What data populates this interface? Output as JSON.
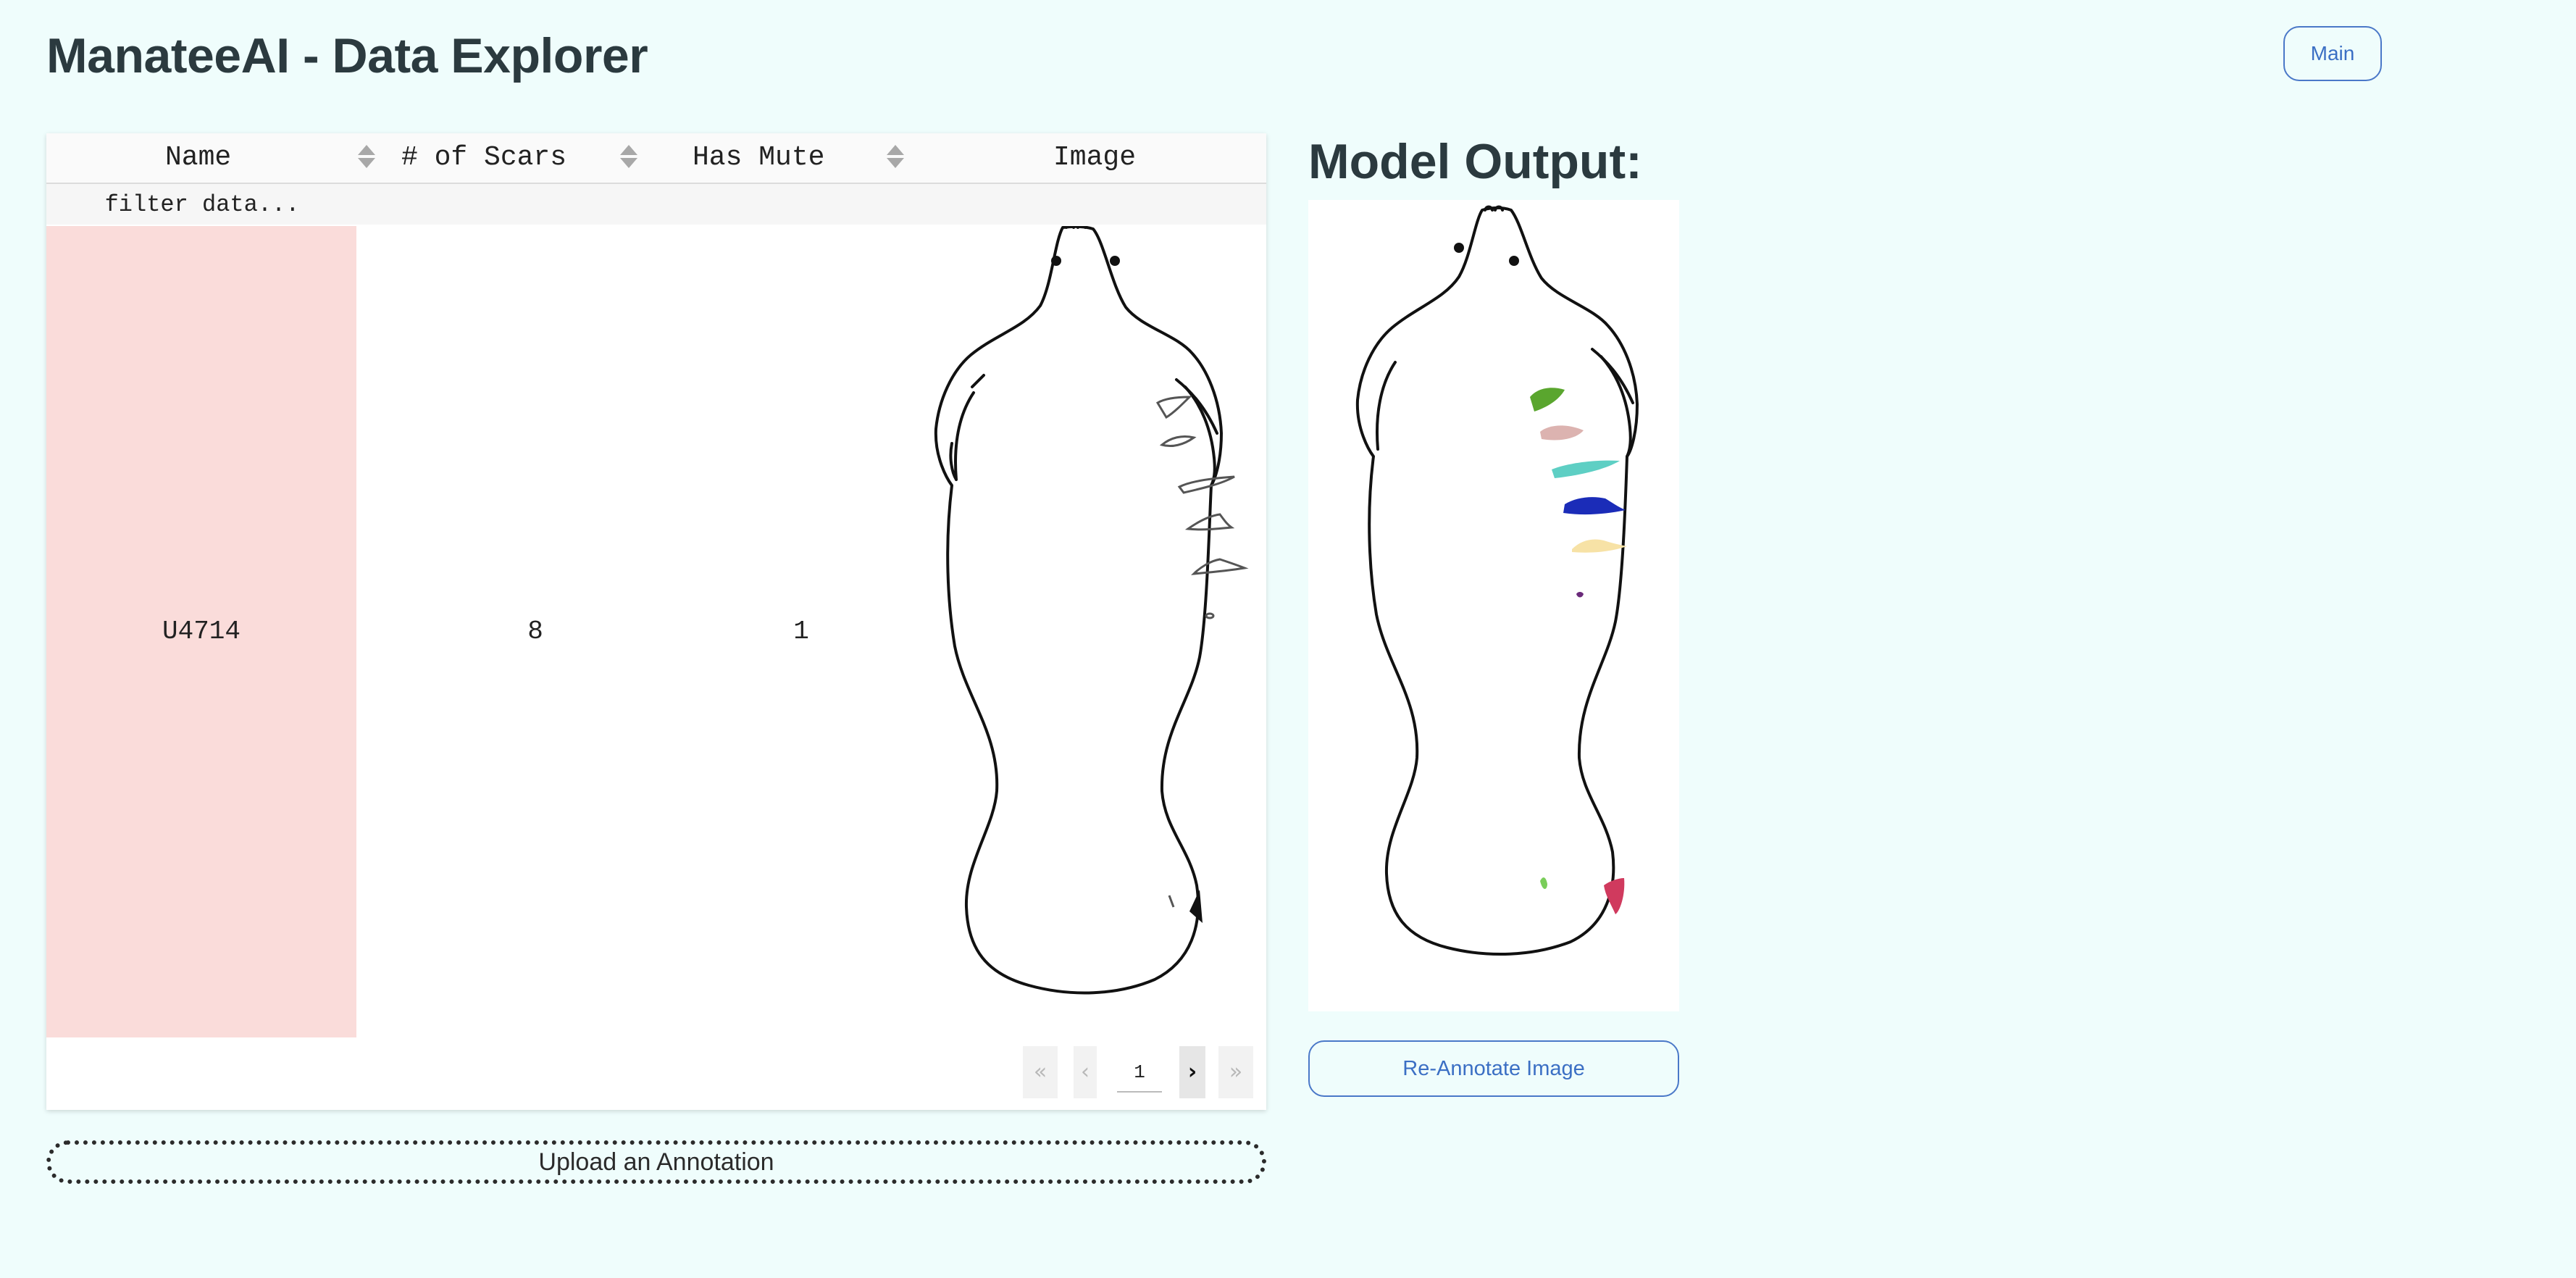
{
  "app": {
    "title": "ManateeAI - Data Explorer",
    "main_label": "Main"
  },
  "table": {
    "columns": [
      {
        "label": "Name",
        "sortable": true
      },
      {
        "label": "# of Scars",
        "sortable": true
      },
      {
        "label": "Has Mute",
        "sortable": true
      },
      {
        "label": "Image",
        "sortable": false
      }
    ],
    "filter_placeholder": "filter data...",
    "rows": [
      {
        "name": "U4714",
        "scars": "8",
        "has_mute": "1",
        "image": "manatee-scar-sketch"
      }
    ],
    "pagination": {
      "first": "«",
      "prev": "‹",
      "page": "1",
      "next": "›",
      "last": "»"
    }
  },
  "upload_label": "Upload an Annotation",
  "output": {
    "title": "Model Output:",
    "reannotate_label": "Re-Annotate Image",
    "scar_colors": [
      "#5aa62e",
      "#dcb3b0",
      "#5ecfc4",
      "#1b2cb8",
      "#f7e2a6",
      "#6a2a7a",
      "#7acd5a",
      "#d03a5e"
    ]
  },
  "colors": {
    "background": "#effdfc",
    "selected_cell": "#fadcda",
    "accent": "#3b6fc4"
  }
}
